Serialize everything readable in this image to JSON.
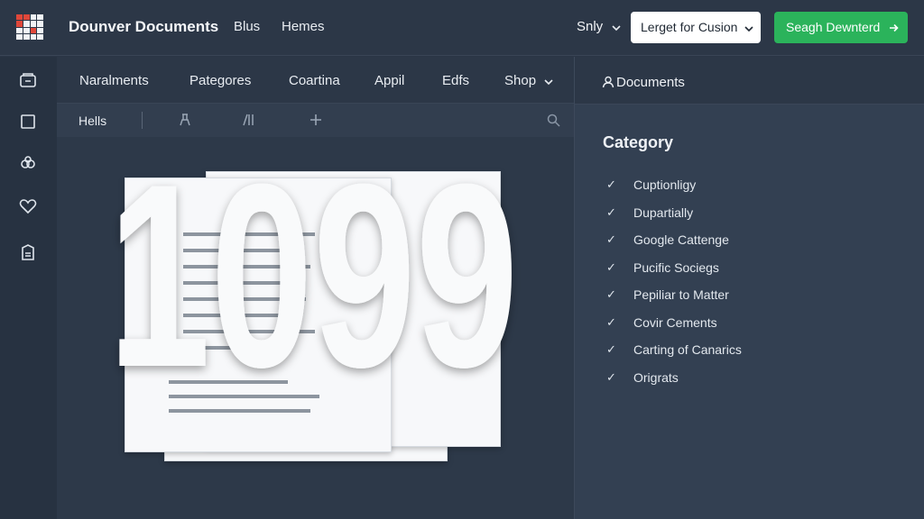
{
  "header": {
    "app_title": "Dounver Documents",
    "nav": [
      "Blus",
      "Hemes"
    ],
    "sort_label": "Snly",
    "select_label": "Lerget for Cusion",
    "action_label": "Seagh Dewnterd"
  },
  "tabs": [
    "Naralments",
    "Pategores",
    "Coartina",
    "Appil",
    "Edfs",
    "Shop"
  ],
  "toolbar": {
    "label": "Hells"
  },
  "rail_icons": [
    "inbox-icon",
    "square-icon",
    "group-icon",
    "heart-icon",
    "clipboard-icon"
  ],
  "artwork": {
    "headline": "1099"
  },
  "panel": {
    "title": "Documents",
    "category_title": "Category",
    "categories": [
      "Cuptionligy",
      "Dupartially",
      "Google Cattenge",
      "Pucific Sociegs",
      "Pepiliar to Matter",
      "Covir Cements",
      "Carting of Canarics",
      "Origrats"
    ]
  },
  "colors": {
    "accent_green": "#2bb35b",
    "logo_red": "#e0473a",
    "background": "#2b3646"
  }
}
